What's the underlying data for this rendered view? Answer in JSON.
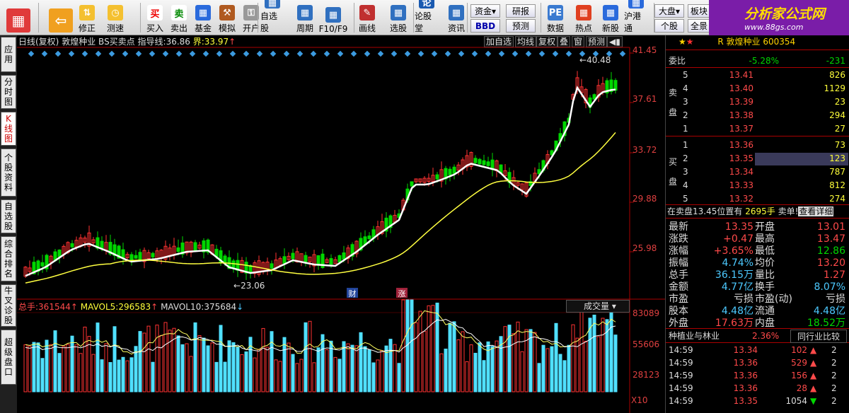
{
  "toolbar": {
    "buttons": [
      {
        "label": "",
        "icon": "app-logo-icon"
      },
      {
        "label": "",
        "icon": "back-arrow-icon"
      },
      {
        "label": "修正",
        "icon": "updown-icon"
      },
      {
        "label": "测速",
        "icon": "clock-icon"
      },
      {
        "label": "买入",
        "icon": "buy-icon",
        "glyph": "买"
      },
      {
        "label": "卖出",
        "icon": "sell-icon",
        "glyph": "卖"
      },
      {
        "label": "基金",
        "icon": "fund-icon"
      },
      {
        "label": "模拟",
        "icon": "hammer-icon"
      },
      {
        "label": "开户",
        "icon": "lock-icon"
      },
      {
        "label": "自选股",
        "icon": "star-list-icon"
      },
      {
        "label": "周期",
        "icon": "period-icon"
      },
      {
        "label": "F10/F9",
        "icon": "f10-icon"
      },
      {
        "label": "画线",
        "icon": "pen-icon"
      },
      {
        "label": "选股",
        "icon": "select-stock-icon"
      },
      {
        "label": "论股堂",
        "icon": "forum-icon",
        "glyph": "论"
      },
      {
        "label": "资讯",
        "icon": "news-icon"
      },
      {
        "label": "数据",
        "icon": "pe-icon",
        "glyph": "PE"
      },
      {
        "label": "热点",
        "icon": "hot-icon"
      },
      {
        "label": "新股",
        "icon": "new-stock-icon"
      },
      {
        "label": "沪港通",
        "icon": "hk-connect-icon"
      }
    ],
    "small": {
      "fund": "资金",
      "bbd": "BBD",
      "research": "研报",
      "forecast": "预测",
      "market": "大盘",
      "individual": "个股",
      "board": "板块",
      "full": "全景"
    }
  },
  "logo": {
    "title": "分析家公式网",
    "url": "www.88gs.com"
  },
  "vtabs": [
    "应用",
    "分时图",
    "K线图",
    "个股资料",
    "自选股",
    "综合排名",
    "牛叉诊股",
    "超级盘口"
  ],
  "chart": {
    "header": {
      "period": "日线(复权)",
      "name": "敦煌种业",
      "indicator": "BS买卖点",
      "ind_label": "指导线:",
      "ind_value": "36.86",
      "bound_label": "界:",
      "bound_value": "33.97"
    },
    "buttons": [
      "加自选",
      "均线",
      "复权",
      "叠",
      "窗",
      "预测"
    ],
    "price_labels": [
      "41.45",
      "37.61",
      "33.72",
      "29.88",
      "25.98"
    ],
    "high_mark": "40.48",
    "low_mark": "23.06",
    "events": [
      "财",
      "涨"
    ],
    "vol_header": {
      "total_label": "总手:",
      "total_value": "361544",
      "ma5_label": "MAVOL5:",
      "ma5_value": "296583",
      "ma10_label": "MAVOL10:",
      "ma10_value": "375684"
    },
    "vol_dropdown": "成交量",
    "vol_labels": [
      "83089",
      "55606",
      "28123"
    ],
    "vol_unit": "X10",
    "colors": {
      "up": "#ff3232",
      "down": "#00d700",
      "ma_fast": "#ffffff",
      "ma_slow": "#ffff40",
      "vol_down": "#50e0ff",
      "signal": "#3c9be0"
    }
  },
  "quote": {
    "title": "敦煌种业",
    "code": "600354",
    "title_prefix": "R",
    "weibi_label": "委比",
    "weibi_pct": "-5.28%",
    "weibi_val": "-231",
    "sell_label": [
      "卖",
      "盘"
    ],
    "buy_label": [
      "买",
      "盘"
    ],
    "sells": [
      {
        "lv": "5",
        "price": "13.41",
        "vol": "826"
      },
      {
        "lv": "4",
        "price": "13.40",
        "vol": "1129"
      },
      {
        "lv": "3",
        "price": "13.39",
        "vol": "23"
      },
      {
        "lv": "2",
        "price": "13.38",
        "vol": "294"
      },
      {
        "lv": "1",
        "price": "13.37",
        "vol": "27"
      }
    ],
    "buys": [
      {
        "lv": "1",
        "price": "13.36",
        "vol": "73"
      },
      {
        "lv": "2",
        "price": "13.35",
        "vol": "123"
      },
      {
        "lv": "3",
        "price": "13.34",
        "vol": "787"
      },
      {
        "lv": "4",
        "price": "13.33",
        "vol": "812"
      },
      {
        "lv": "5",
        "price": "13.32",
        "vol": "274"
      }
    ],
    "notice": {
      "text": "在卖盘13.45位置有",
      "vol": "2695手",
      "action": "卖单!",
      "link": "查看详细"
    },
    "stats": [
      {
        "l1": "最新",
        "v1": "13.35",
        "l2": "开盘",
        "v2": "13.01"
      },
      {
        "l1": "涨跌",
        "v1": "+0.47",
        "l2": "最高",
        "v2": "13.47"
      },
      {
        "l1": "涨幅",
        "v1": "+3.65%",
        "l2": "最低",
        "v2": "12.86"
      },
      {
        "l1": "振幅",
        "v1": "4.74%",
        "l2": "均价",
        "v2": "13.20"
      },
      {
        "l1": "总手",
        "v1": "36.15万",
        "l2": "量比",
        "v2": "1.27"
      },
      {
        "l1": "金额",
        "v1": "4.77亿",
        "l2": "换手",
        "v2": "8.07%"
      },
      {
        "l1": "市盈",
        "v1": "亏损",
        "l2": "市盈(动)",
        "v2": "亏损"
      },
      {
        "l1": "股本",
        "v1": "4.48亿",
        "l2": "流通",
        "v2": "4.48亿"
      },
      {
        "l1": "外盘",
        "v1": "17.63万",
        "l2": "内盘",
        "v2": "18.52万"
      }
    ],
    "industry": {
      "name": "种植业与林业",
      "pct": "2.36%",
      "compare": "同行业比较"
    },
    "ticks": [
      {
        "time": "14:59",
        "price": "13.34",
        "vol": "102"
      },
      {
        "time": "14:59",
        "price": "13.36",
        "vol": "529"
      },
      {
        "time": "14:59",
        "price": "13.36",
        "vol": "156"
      },
      {
        "time": "14:59",
        "price": "13.36",
        "vol": "28"
      },
      {
        "time": "14:59",
        "price": "13.35",
        "vol": "1054"
      }
    ]
  }
}
